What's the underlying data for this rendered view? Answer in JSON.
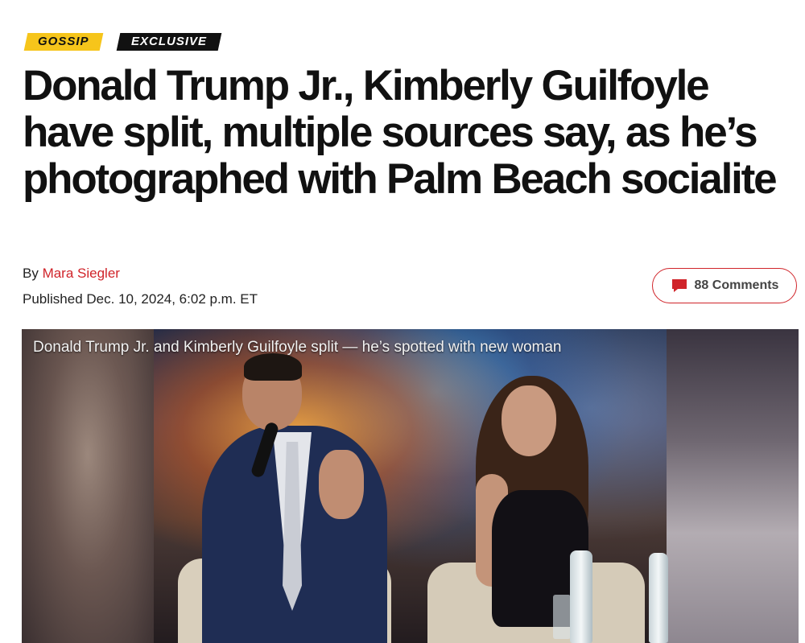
{
  "tags": {
    "gossip": "GOSSIP",
    "exclusive": "EXCLUSIVE"
  },
  "colors": {
    "accent_red": "#d0242a",
    "gossip_yellow": "#f6c51b",
    "exclusive_black": "#111111"
  },
  "article": {
    "headline": "Donald Trump Jr., Kimberly Guilfoyle have split, multiple sources say, as he’s photographed with Palm Beach socialite",
    "byline_prefix": "By ",
    "author": "Mara Siegler",
    "published": "Published Dec. 10, 2024, 6:02 p.m. ET"
  },
  "comments": {
    "label": "88 Comments",
    "icon": "speech-bubble-icon"
  },
  "media": {
    "caption": "Donald Trump Jr. and Kimberly Guilfoyle split — he’s spotted with new woman"
  }
}
